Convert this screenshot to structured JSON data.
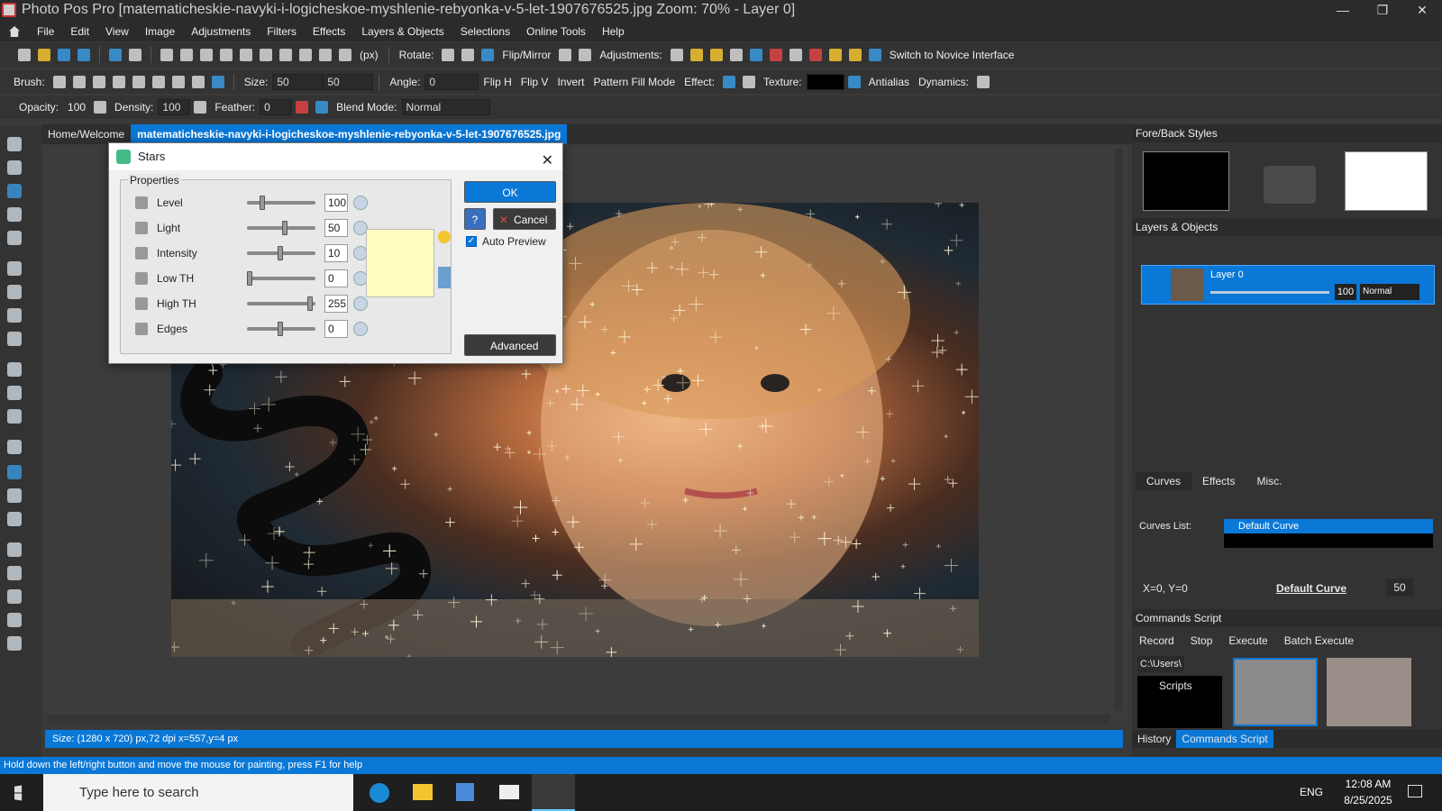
{
  "window": {
    "title": "Photo Pos Pro [matematicheskie-navyki-i-logicheskoe-myshlenie-rebyonka-v-5-let-1907676525.jpg Zoom: 70% - Layer 0]"
  },
  "menu": [
    "File",
    "Edit",
    "View",
    "Image",
    "Adjustments",
    "Filters",
    "Effects",
    "Layers & Objects",
    "Selections",
    "Online Tools",
    "Help"
  ],
  "toolbar1": {
    "units": "(px)",
    "rotate": "Rotate:",
    "flip_mirror": "Flip/Mirror",
    "adjustments": "Adjustments:",
    "novice": "Switch to Novice Interface"
  },
  "toolbar2": {
    "brush": "Brush:",
    "size_label": "Size:",
    "size1": "50",
    "size2": "50",
    "angle_label": "Angle:",
    "angle": "0",
    "flip_h": "Flip H",
    "flip_v": "Flip V",
    "invert": "Invert",
    "pattern": "Pattern Fill Mode",
    "effect": "Effect:",
    "texture": "Texture:",
    "antialias": "Antialias",
    "dynamics": "Dynamics:"
  },
  "toolbar3": {
    "opacity_label": "Opacity:",
    "opacity": "100",
    "density_label": "Density:",
    "density": "100",
    "feather_label": "Feather:",
    "feather": "0",
    "blend_label": "Blend Mode:",
    "blend": "Normal"
  },
  "doc_tabs": {
    "home": "Home/Welcome",
    "file": "matematicheskie-navyki-i-logicheskoe-myshlenie-rebyonka-v-5-let-1907676525.jpg"
  },
  "doc_status": "Size: (1280 x 720) px,72 dpi   x=557,y=4 px",
  "hint": "Hold down the left/right button and move the mouse for painting, press F1 for help",
  "dialog": {
    "title": "Stars",
    "group": "Properties",
    "ok": "OK",
    "cancel": "Cancel",
    "help": "?",
    "auto_preview": "Auto Preview",
    "advanced": "Advanced",
    "rows": [
      {
        "label": "Level",
        "value": "100",
        "level": 0.2
      },
      {
        "label": "Light",
        "value": "50",
        "level": 0.55
      },
      {
        "label": "Intensity",
        "value": "10",
        "level": 0.48
      },
      {
        "label": "Low TH",
        "value": "0",
        "level": 0.0
      },
      {
        "label": "High TH",
        "value": "255",
        "level": 0.95
      },
      {
        "label": "Edges",
        "value": "0",
        "level": 0.48
      }
    ],
    "swatch_color": "#fffdc0"
  },
  "panels": {
    "fore_back": "Fore/Back Styles",
    "layers": "Layers & Objects",
    "layer_name": "Layer 0",
    "layer_opacity": "100",
    "layer_blend": "Normal",
    "tabs": [
      "Curves",
      "Effects",
      "Misc."
    ],
    "curves_list": "Curves List:",
    "default_curve": "Default Curve",
    "coords": "X=0, Y=0",
    "curve_link": "Default Curve",
    "curve_value": "50",
    "commands": "Commands Script",
    "record": "Record",
    "stop": "Stop",
    "execute": "Execute",
    "batch": "Batch Execute",
    "path": "C:\\Users\\",
    "scripts": "Scripts",
    "bottom_tabs": [
      "History",
      "Commands Script"
    ]
  },
  "taskbar": {
    "search": "Type here to search",
    "lang": "ENG",
    "time": "12:08 AM",
    "date": "8/25/2025"
  }
}
